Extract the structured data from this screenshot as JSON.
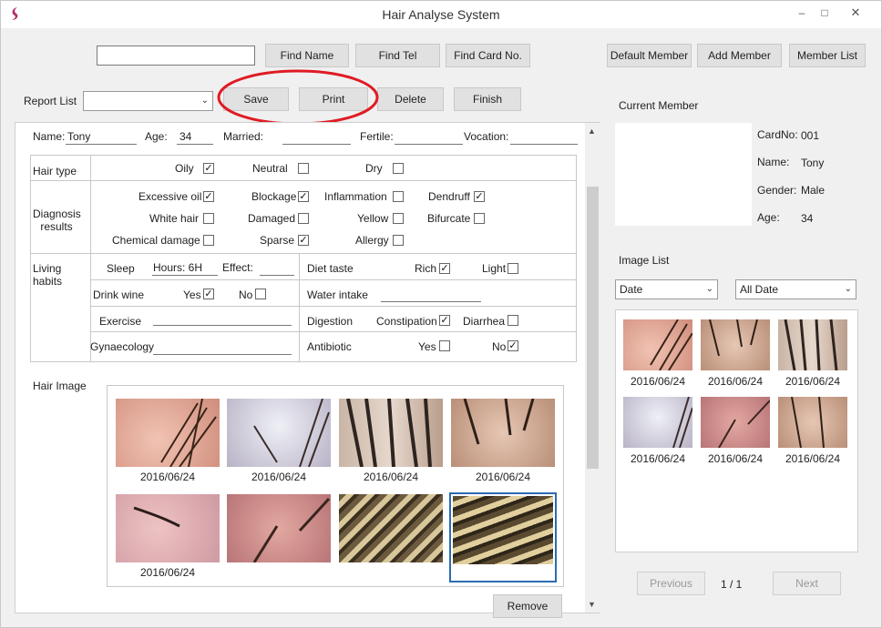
{
  "window": {
    "title": "Hair Analyse System",
    "min": "–",
    "max": "□",
    "close": "✕"
  },
  "toolbar": {
    "find_name": "Find Name",
    "find_tel": "Find Tel",
    "find_card": "Find Card No.",
    "default_member": "Default Member",
    "add_member": "Add Member",
    "member_list": "Member List",
    "search_value": ""
  },
  "report": {
    "label": "Report List",
    "selected": "",
    "save": "Save",
    "print": "Print",
    "delete": "Delete",
    "finish": "Finish"
  },
  "form": {
    "name_label": "Name:",
    "name": "Tony",
    "age_label": "Age:",
    "age": "34",
    "married_label": "Married:",
    "married": "",
    "fertile_label": "Fertile:",
    "fertile": "",
    "vocation_label": "Vocation:",
    "vocation": "",
    "hair_type": "Hair type",
    "oily": "Oily",
    "neutral": "Neutral",
    "dry": "Dry",
    "diagnosis": "Diagnosis results",
    "excessive_oil": "Excessive oil",
    "blockage": "Blockage",
    "inflammation": "Inflammation",
    "dendruff": "Dendruff",
    "white_hair": "White hair",
    "damaged": "Damaged",
    "yellow": "Yellow",
    "bifurcate": "Bifurcate",
    "chemical_damage": "Chemical damage",
    "sparse": "Sparse",
    "allergy": "Allergy",
    "living": "Living habits",
    "sleep": "Sleep",
    "hours": "Hours: 6H",
    "effect": "Effect:",
    "diet": "Diet taste",
    "rich": "Rich",
    "light": "Light",
    "drink": "Drink wine",
    "yes": "Yes",
    "no": "No",
    "water": "Water intake",
    "exercise": "Exercise",
    "digestion": "Digestion",
    "constipation": "Constipation",
    "diarrhea": "Diarrhea",
    "gyn": "Gynaecology",
    "antibiotic": "Antibiotic"
  },
  "hair_image": {
    "label": "Hair Image",
    "remove": "Remove",
    "dates": [
      "2016/06/24",
      "2016/06/24",
      "2016/06/24",
      "2016/06/24",
      "2016/06/24"
    ]
  },
  "member": {
    "section": "Current Member",
    "card_label": "CardNo:",
    "card": "001",
    "name_label": "Name:",
    "name": "Tony",
    "gender_label": "Gender:",
    "gender": "Male",
    "age_label": "Age:",
    "age": "34"
  },
  "image_list": {
    "section": "Image List",
    "filter1": "Date",
    "filter2": "All Date",
    "dates": [
      "2016/06/24",
      "2016/06/24",
      "2016/06/24",
      "2016/06/24",
      "2016/06/24",
      "2016/06/24"
    ],
    "previous": "Previous",
    "page": "1 / 1",
    "next": "Next"
  },
  "colors": {
    "annotation": "#e01b24",
    "selection": "#2a6cb0"
  }
}
